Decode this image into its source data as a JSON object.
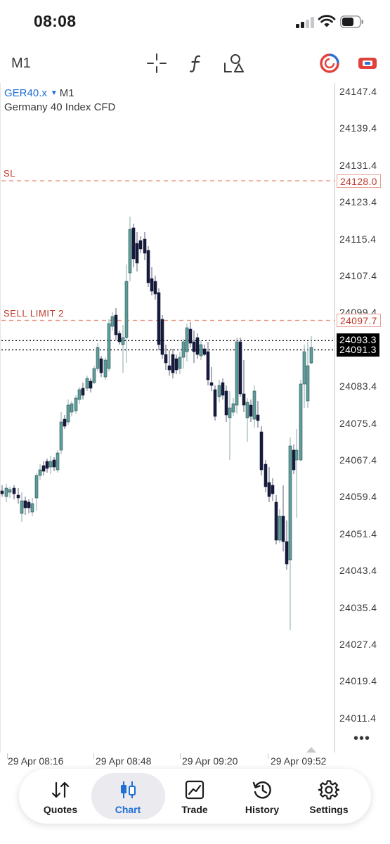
{
  "status_bar": {
    "time": "08:08"
  },
  "toolbar": {
    "timeframe": "M1",
    "icons": [
      "crosshair-icon",
      "function-icon",
      "objects-icon",
      "one-click-trading-icon",
      "trade-toggle-icon"
    ]
  },
  "chart": {
    "symbol": "GER40.x",
    "symbol_caret": "▼",
    "timeframe": "M1",
    "description": "Germany 40 Index CFD",
    "y_axis_labels": [
      "24147.4",
      "24139.4",
      "24131.4",
      "24123.4",
      "24115.4",
      "24107.4",
      "24099.4",
      "24083.4",
      "24075.4",
      "24067.4",
      "24059.4",
      "24051.4",
      "24043.4",
      "24035.4",
      "24027.4",
      "24019.4",
      "24011.4"
    ],
    "levels": {
      "sl": {
        "label": "SL",
        "price": "24128.0"
      },
      "sell_limit": {
        "label": "SELL LIMIT 2",
        "price": "24097.7"
      },
      "ask": {
        "price": "24093.3"
      },
      "bid": {
        "price": "24091.3"
      }
    },
    "x_axis_labels": [
      "29 Apr 08:16",
      "29 Apr 08:48",
      "29 Apr 09:20",
      "29 Apr 09:52"
    ],
    "more_label": "•••",
    "colors": {
      "bull": "#5d9e9b",
      "bear": "#171a3b",
      "level": "#e8907e",
      "level_text": "#c0392b",
      "tag_black": "#000000"
    }
  },
  "tabs": {
    "active": "Chart",
    "items": [
      {
        "label": "Quotes",
        "icon": "quotes-arrows-icon"
      },
      {
        "label": "Chart",
        "icon": "candles-icon"
      },
      {
        "label": "Trade",
        "icon": "trade-chart-icon"
      },
      {
        "label": "History",
        "icon": "history-icon"
      },
      {
        "label": "Settings",
        "icon": "settings-gear-icon"
      }
    ]
  }
}
